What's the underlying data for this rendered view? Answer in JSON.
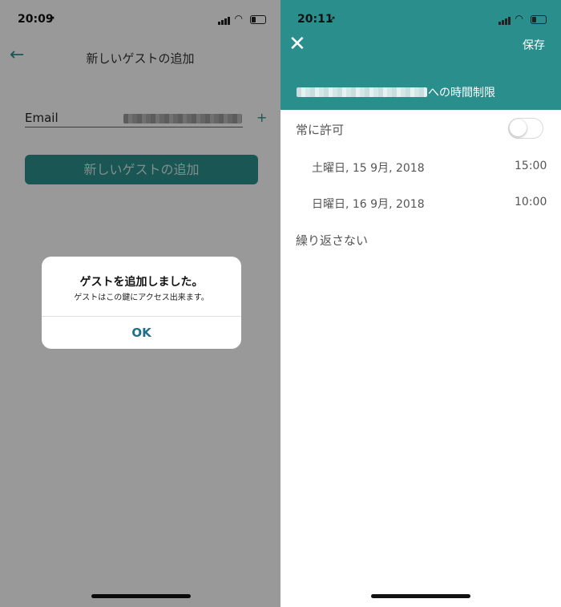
{
  "left": {
    "status_time": "20:09",
    "title": "新しいゲストの追加",
    "email_label": "Email",
    "plus_label": "+",
    "add_button_label": "新しいゲストの追加",
    "dialog": {
      "title": "ゲストを追加しました。",
      "message": "ゲストはこの鍵にアクセス出来ます。",
      "ok_label": "OK"
    }
  },
  "right": {
    "status_time": "20:11",
    "save_label": "保存",
    "header_suffix": "への時間制限",
    "always_allow_label": "常に許可",
    "always_allow_on": false,
    "start_date": "土曜日, 15 9月, 2018",
    "start_time": "15:00",
    "end_date": "日曜日, 16 9月, 2018",
    "end_time": "10:00",
    "repeat_label": "繰り返さない"
  },
  "colors": {
    "accent": "#2a8f8c",
    "dialog_link": "#1f6e8c"
  }
}
